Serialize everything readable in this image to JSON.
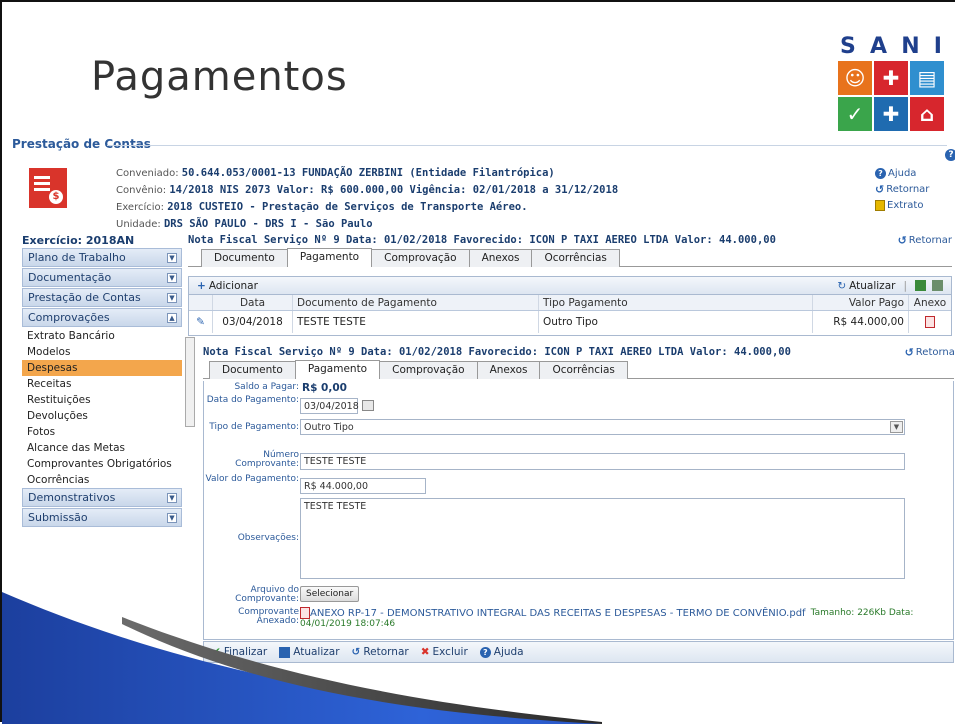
{
  "slide_title": "Pagamentos",
  "logo": {
    "word": "SANI",
    "colors": [
      "#e8731c",
      "#2f8fcf",
      "#3aa54b",
      "#2a8a3a",
      "#1f6bb0",
      "#d7262d"
    ]
  },
  "section_legend": "Prestação de Contas",
  "header": {
    "conveniado_label": "Conveniado:",
    "conveniado_value": "50.644.053/0001-13 FUNDAÇÃO ZERBINI (Entidade Filantrópica)",
    "convenio_label": "Convênio:",
    "convenio_value": "14/2018 NIS 2073 Valor: R$ 600.000,00 Vigência: 02/01/2018 a 31/12/2018",
    "exercicio_label": "Exercício:",
    "exercicio_value": "2018 CUSTEIO - Prestação de Serviços de Transporte Aéreo.",
    "unidade_label": "Unidade:",
    "unidade_value": "DRS SÃO PAULO - DRS I - São Paulo",
    "links": {
      "ajuda": "Ajuda",
      "retornar": "Retornar",
      "extrato": "Extrato"
    }
  },
  "sidebar": {
    "title": "Exercício: 2018AN",
    "groups_top": [
      "Plano de Trabalho",
      "Documentação",
      "Prestação de Contas",
      "Comprovações"
    ],
    "items": [
      "Extrato Bancário",
      "Modelos",
      "Despesas",
      "Receitas",
      "Restituições",
      "Devoluções",
      "Fotos",
      "Alcance das Metas",
      "Comprovantes Obrigatórios",
      "Ocorrências"
    ],
    "active_item": "Despesas",
    "groups_bottom": [
      "Demonstrativos",
      "Submissão"
    ]
  },
  "nota": {
    "title": "Nota Fiscal Serviço Nº 9 Data: 01/02/2018 Favorecido: ICON P TAXI AEREO LTDA Valor: 44.000,00",
    "retornar": "Retornar",
    "tabs": [
      "Documento",
      "Pagamento",
      "Comprovação",
      "Anexos",
      "Ocorrências"
    ],
    "active_tab": "Pagamento"
  },
  "grid": {
    "add_label": "Adicionar",
    "refresh_label": "Atualizar",
    "columns": [
      "Data",
      "Documento de Pagamento",
      "Tipo Pagamento",
      "Valor Pago",
      "Anexo"
    ],
    "rows": [
      {
        "data": "03/04/2018",
        "documento": "TESTE TESTE",
        "tipo": "Outro Tipo",
        "valor": "R$ 44.000,00"
      }
    ]
  },
  "form": {
    "title": "Nota Fiscal Serviço Nº 9 Data: 01/02/2018 Favorecido: ICON P TAXI AEREO LTDA Valor: 44.000,00",
    "retornar": "Retornar",
    "saldo_label": "Saldo a Pagar:",
    "saldo_value": "R$ 0,00",
    "data_label": "Data do Pagamento:",
    "data_value": "03/04/2018",
    "tipo_label": "Tipo de Pagamento:",
    "tipo_value": "Outro Tipo",
    "numero_label": "Número Comprovante:",
    "numero_value": "TESTE TESTE",
    "valor_label": "Valor do Pagamento:",
    "valor_value": "R$ 44.000,00",
    "obs_label": "Observações:",
    "obs_value": "TESTE TESTE",
    "arquivo_label": "Arquivo do Comprovante:",
    "arquivo_button": "Selecionar",
    "anexado_label": "Comprovante Anexado:",
    "anexado_file": "ANEXO RP-17 - DEMONSTRATIVO INTEGRAL DAS RECEITAS E DESPESAS - TERMO DE CONVÊNIO.pdf",
    "anexado_meta": "Tamanho: 226Kb Data:",
    "anexado_date": "04/01/2019 18:07:46"
  },
  "footer_buttons": [
    "Finalizar",
    "Atualizar",
    "Retornar",
    "Excluir",
    "Ajuda"
  ]
}
